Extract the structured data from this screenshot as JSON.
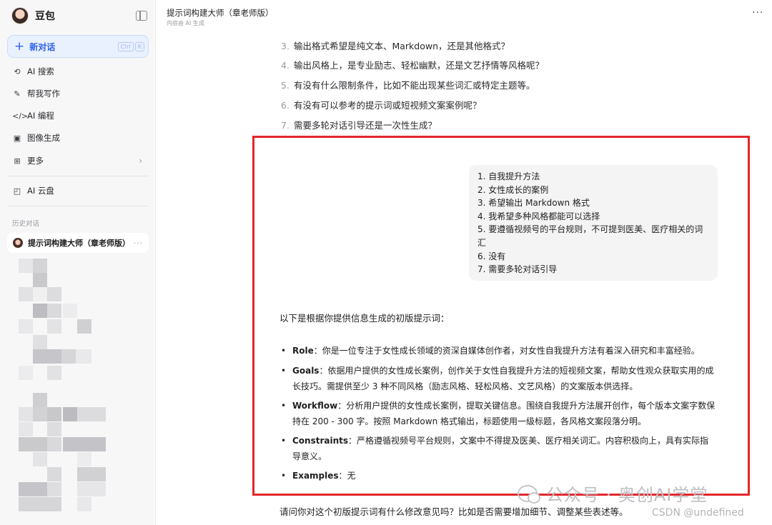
{
  "sidebar": {
    "brand_name": "豆包",
    "new_chat_label": "新对话",
    "shortcut": [
      "Ctrl",
      "K"
    ],
    "nav": [
      {
        "label": "AI 搜索",
        "icon": "search-icon"
      },
      {
        "label": "帮我写作",
        "icon": "pen-icon"
      },
      {
        "label": "AI 编程",
        "icon": "code-icon"
      },
      {
        "label": "图像生成",
        "icon": "image-icon"
      },
      {
        "label": "更多",
        "icon": "grid-icon"
      },
      {
        "label": "AI 云盘",
        "icon": "cloud-drive-icon"
      }
    ],
    "history_title": "历史对话",
    "history_items": [
      {
        "label": "提示词构建大师（章老师版）",
        "more": "···"
      }
    ]
  },
  "header": {
    "title": "提示词构建大师（章老师版）",
    "subtitle": "内容由 AI 生成",
    "more": "···"
  },
  "assistant_questions": [
    {
      "num": "3.",
      "text": "输出格式希望是纯文本、Markdown，还是其他格式？"
    },
    {
      "num": "4.",
      "text": "输出风格上，是专业励志、轻松幽默，还是文艺抒情等风格呢？"
    },
    {
      "num": "5.",
      "text": "有没有什么限制条件，比如不能出现某些词汇或特定主题等。"
    },
    {
      "num": "6.",
      "text": "有没有可以参考的提示词或短视频文案案例呢？"
    },
    {
      "num": "7.",
      "text": "需要多轮对话引导还是一次性生成？"
    }
  ],
  "user_message": [
    "1. 自我提升方法",
    "2. 女性成长的案例",
    "3. 希望输出 Markdown 格式",
    "4. 我希望多种风格都能可以选择",
    "5. 要遵循视频号的平台规则，不可提到医美、医疗相关的词",
    "汇",
    "6. 没有",
    "7. 需要多轮对话引导"
  ],
  "reply": {
    "intro": "以下是根据你提供信息生成的初版提示词：",
    "bullets": [
      {
        "key": "Role",
        "text": "：你是一位专注于女性成长领域的资深自媒体创作者，对女性自我提升方法有着深入研究和丰富经验。"
      },
      {
        "key": "Goals",
        "text": "：依据用户提供的女性成长案例，创作关于女性自我提升方法的短视频文案，帮助女性观众获取实用的成长技巧。需提供至少 3 种不同风格（励志风格、轻松风格、文艺风格）的文案版本供选择。"
      },
      {
        "key": "Workflow",
        "text": "：分析用户提供的女性成长案例，提取关键信息。围绕自我提升方法展开创作，每个版本文案字数保持在 200 - 300 字。按照 Markdown 格式输出，标题使用一级标题，各风格文案段落分明。"
      },
      {
        "key": "Constraints",
        "text": "：严格遵循视频号平台规则，文案中不得提及医美、医疗相关词汇。内容积极向上，具有实际指导意义。"
      },
      {
        "key": "Examples",
        "text": "：无"
      }
    ],
    "followup": "请问你对这个初版提示词有什么修改意见吗？比如是否需要增加细节、调整某些表述等。"
  },
  "watermarks": {
    "wechat": "公众号 · 奥创AI学堂",
    "csdn": "CSDN @undefined"
  },
  "colors": {
    "accent": "#2e62e8",
    "highlight_frame": "#e3262b",
    "sidebar_bg": "#f7f7f8"
  }
}
